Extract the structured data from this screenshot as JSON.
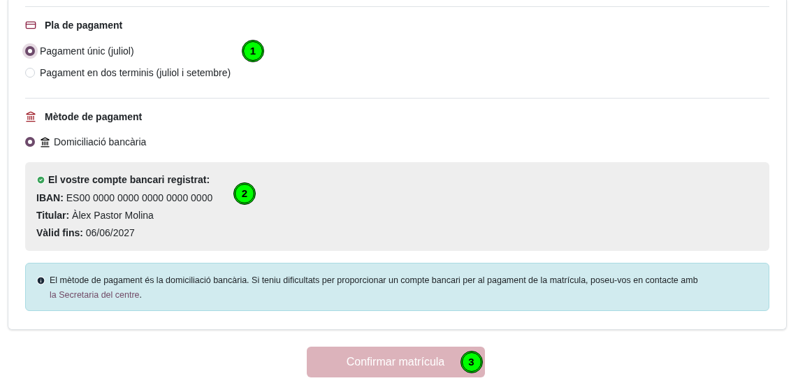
{
  "payment_plan": {
    "title": "Pla de pagament",
    "options": [
      {
        "label": "Pagament únic (juliol)",
        "selected": true
      },
      {
        "label": "Pagament en dos terminis (juliol i setembre)",
        "selected": false
      }
    ]
  },
  "payment_method": {
    "title": "Mètode de pagament",
    "options": [
      {
        "label": "Domiciliació bancària",
        "selected": true
      }
    ]
  },
  "bank_account": {
    "heading": "El vostre compte bancari registrat:",
    "fields": [
      {
        "label": "IBAN:",
        "value": "ES00 0000 0000 0000 0000 0000"
      },
      {
        "label": "Titular:",
        "value": "Àlex Pastor Molina"
      },
      {
        "label": "Vàlid fins:",
        "value": "06/06/2027"
      }
    ]
  },
  "info": {
    "text": "El mètode de pagament és la domiciliació bancària. Si teniu dificultats per proporcionar un compte bancari per al pagament de la matrícula, poseu-vos en contacte amb",
    "link": "la Secretaria del centre",
    "after": "."
  },
  "confirm_button": {
    "label": "Confirmar matrícula",
    "disabled": true
  },
  "markers": [
    "1",
    "2",
    "3"
  ]
}
